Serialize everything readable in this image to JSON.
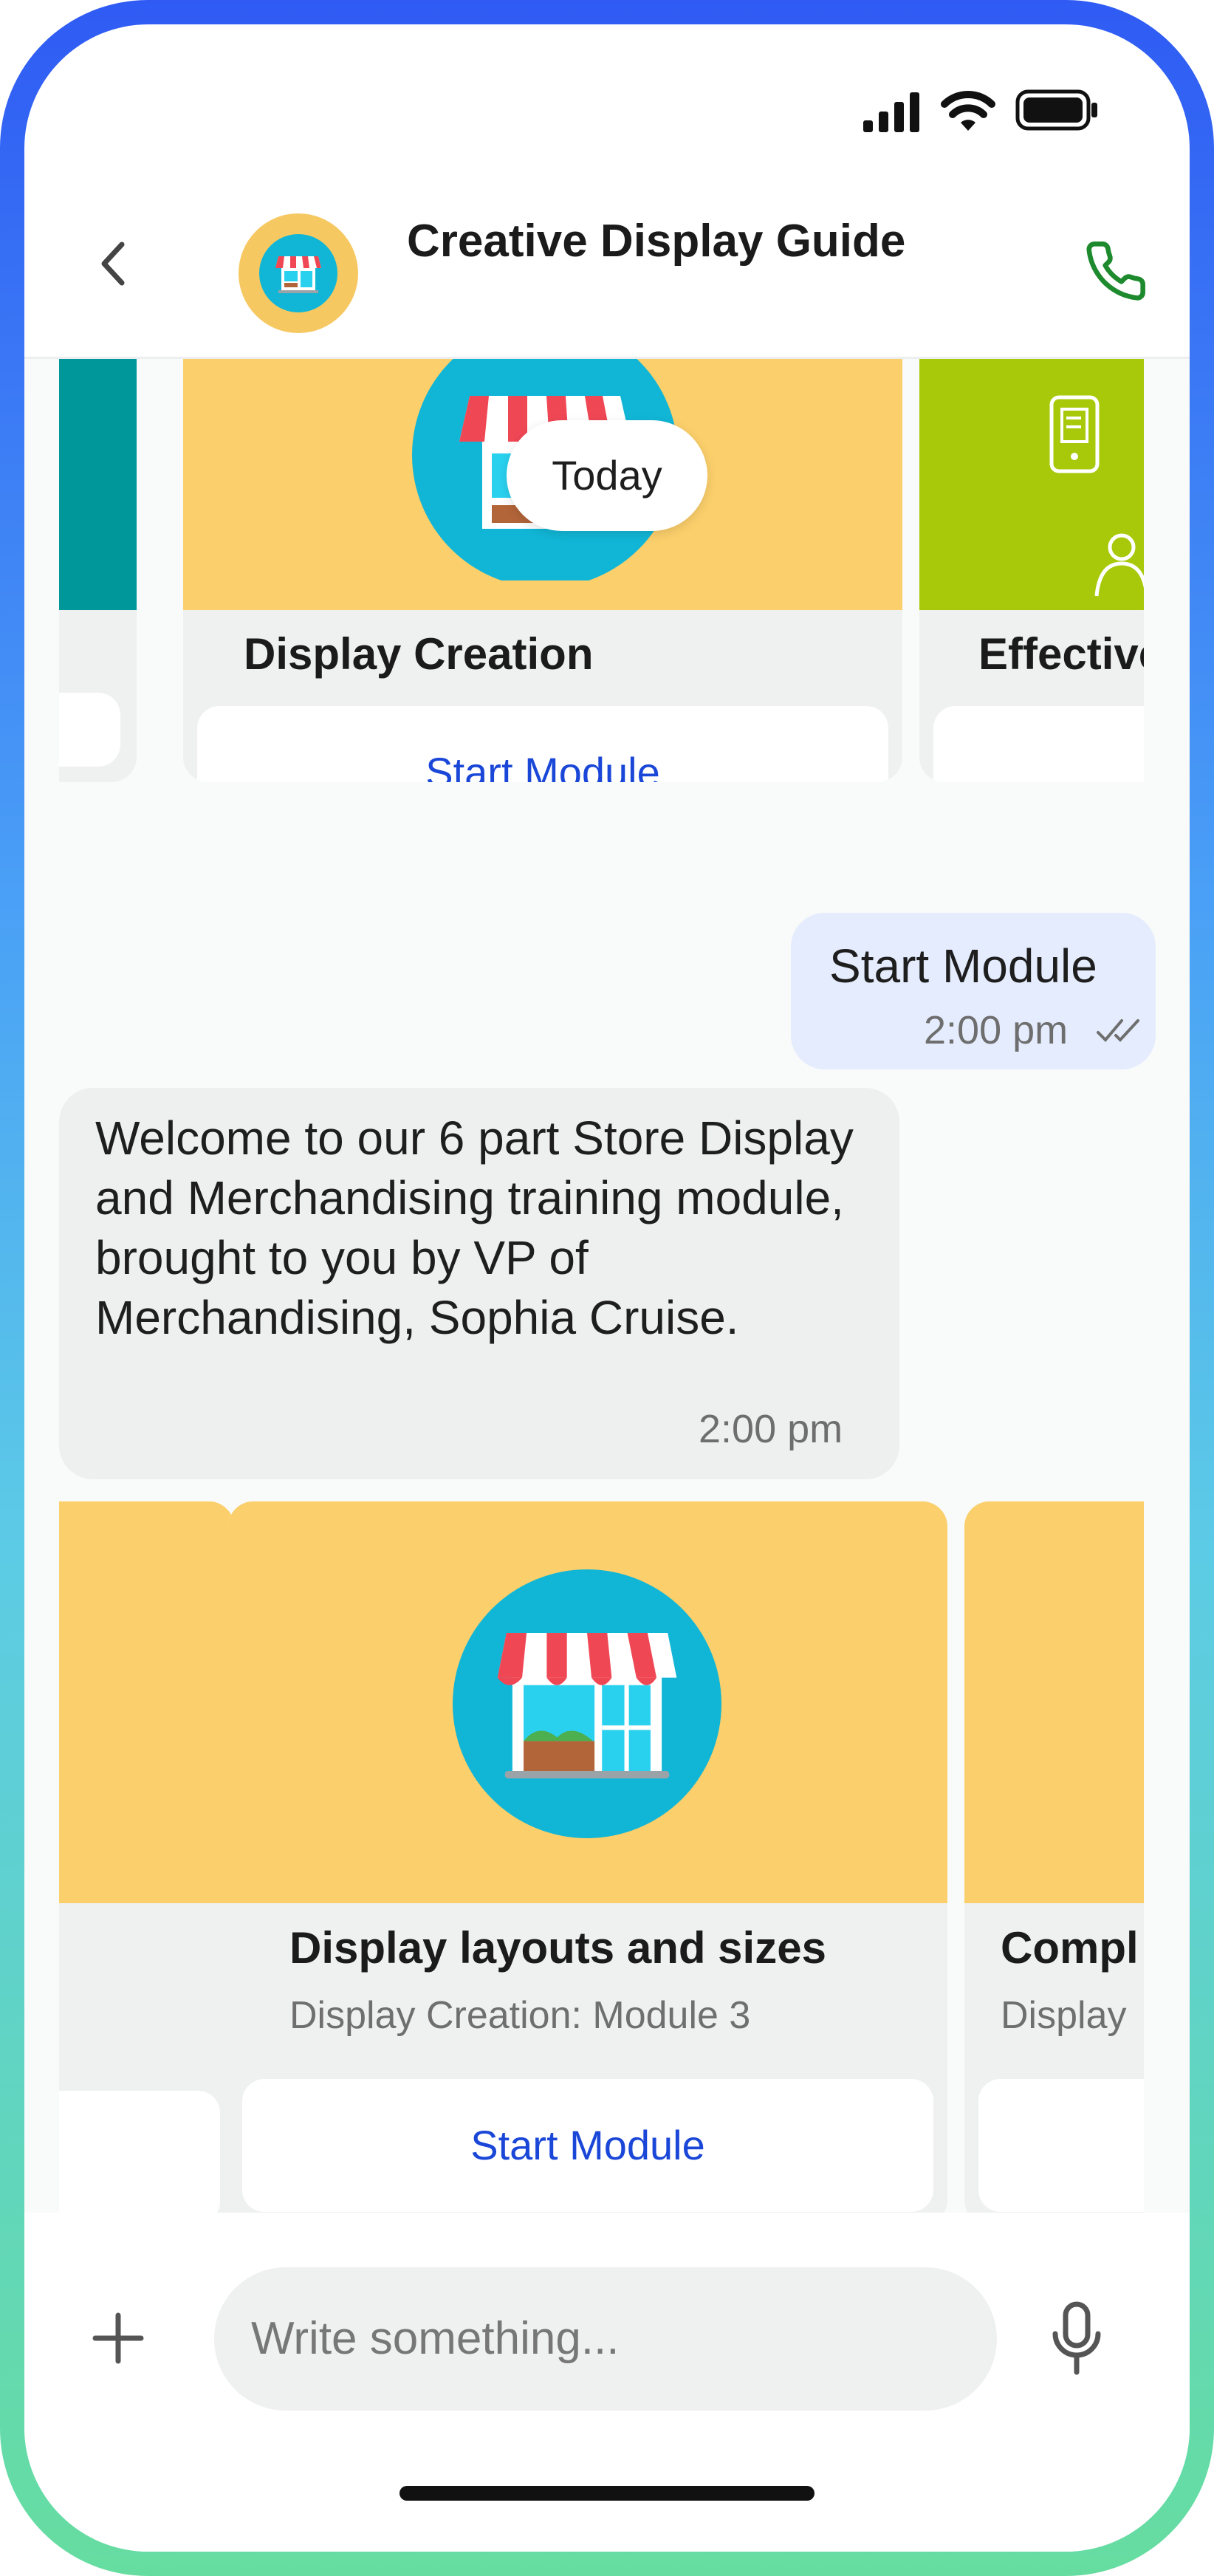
{
  "app": {
    "title": "Creative Display Guide"
  },
  "status_bar": {
    "icons": [
      "signal-icon",
      "wifi-icon",
      "battery-icon"
    ]
  },
  "header": {
    "back_icon": "chevron-left-icon",
    "avatar_icon": "store-icon",
    "call_icon": "phone-icon"
  },
  "chat": {
    "date_separator": "Today",
    "carousel_top": {
      "cards": [
        {
          "title": "Display Creation",
          "button": "Start Module",
          "banner_color": "#fbcf6b"
        },
        {
          "title": "Effective",
          "banner_color": "#a8c80a"
        }
      ],
      "left_partial_banner_color": "#00979a"
    },
    "outgoing": {
      "text": "Start Module",
      "time": "2:00 pm",
      "read_icon": "double-check-icon"
    },
    "incoming": {
      "text": "Welcome to our 6 part Store Display and Merchandising training module, brought to you by VP of Merchandising, Sophia Cruise.",
      "time": "2:00 pm"
    },
    "carousel_bottom": {
      "cards": [
        {
          "title": "Display layouts and sizes",
          "subtitle": "Display Creation: Module 3",
          "button": "Start Module",
          "banner_color": "#fbcf6b"
        },
        {
          "title": "Compl",
          "subtitle": "Display",
          "banner_color": "#fbcf6b"
        }
      ]
    }
  },
  "composer": {
    "placeholder": "Write something...",
    "add_icon": "plus-icon",
    "mic_icon": "microphone-icon"
  },
  "colors": {
    "accent_blue": "#1a47d8",
    "call_green": "#1e8a2e",
    "outgoing_bubble": "#e4ecfd",
    "incoming_bubble": "#eeefef"
  }
}
